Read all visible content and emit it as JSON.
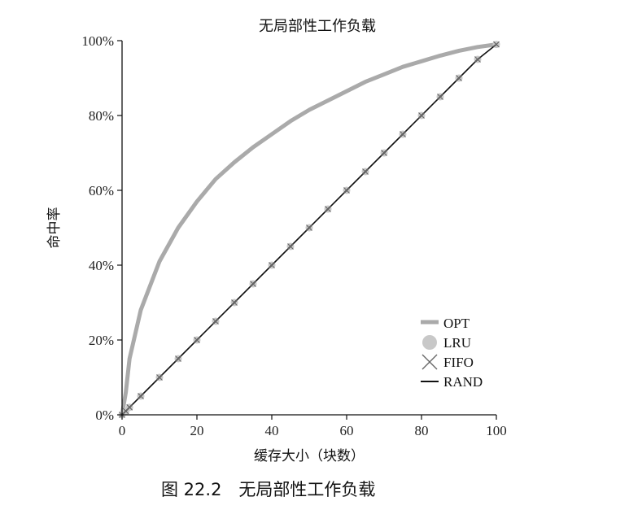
{
  "caption": "图 22.2　无局部性工作负载",
  "chart_data": {
    "type": "line",
    "title": "无局部性工作负载",
    "xlabel": "缓存大小（块数）",
    "ylabel": "命中率",
    "xlim": [
      0,
      100
    ],
    "ylim": [
      0,
      100
    ],
    "x_ticks": [
      "0",
      "20",
      "40",
      "60",
      "80",
      "100"
    ],
    "y_ticks": [
      "0%",
      "20%",
      "40%",
      "60%",
      "80%",
      "100%"
    ],
    "legend_position": "bottom-right",
    "x": [
      0,
      1,
      2,
      5,
      10,
      15,
      20,
      25,
      30,
      35,
      40,
      45,
      50,
      55,
      60,
      65,
      70,
      75,
      80,
      85,
      90,
      95,
      100
    ],
    "series": [
      {
        "name": "OPT",
        "color": "#aaaaaa",
        "values": [
          0,
          6,
          15,
          28,
          41,
          50,
          57,
          63,
          67.5,
          71.5,
          75,
          78.5,
          81.5,
          84,
          86.5,
          89,
          91,
          93,
          94.5,
          96,
          97.3,
          98.3,
          99
        ]
      },
      {
        "name": "LRU",
        "color": "#c8c8c8",
        "values": [
          0,
          1,
          2,
          5,
          10,
          15,
          20,
          25,
          30,
          35,
          40,
          45,
          50,
          55,
          60,
          65,
          70,
          75,
          80,
          85,
          90,
          95,
          99
        ]
      },
      {
        "name": "FIFO",
        "color": "#666666",
        "values": [
          0,
          1,
          2,
          5,
          10,
          15,
          20,
          25,
          30,
          35,
          40,
          45,
          50,
          55,
          60,
          65,
          70,
          75,
          80,
          85,
          90,
          95,
          99
        ]
      },
      {
        "name": "RAND",
        "color": "#111111",
        "values": [
          0,
          1,
          2,
          5,
          10,
          15,
          20,
          25,
          30,
          35,
          40,
          45,
          50,
          55,
          60,
          65,
          70,
          75,
          80,
          85,
          90,
          95,
          99
        ]
      }
    ]
  }
}
